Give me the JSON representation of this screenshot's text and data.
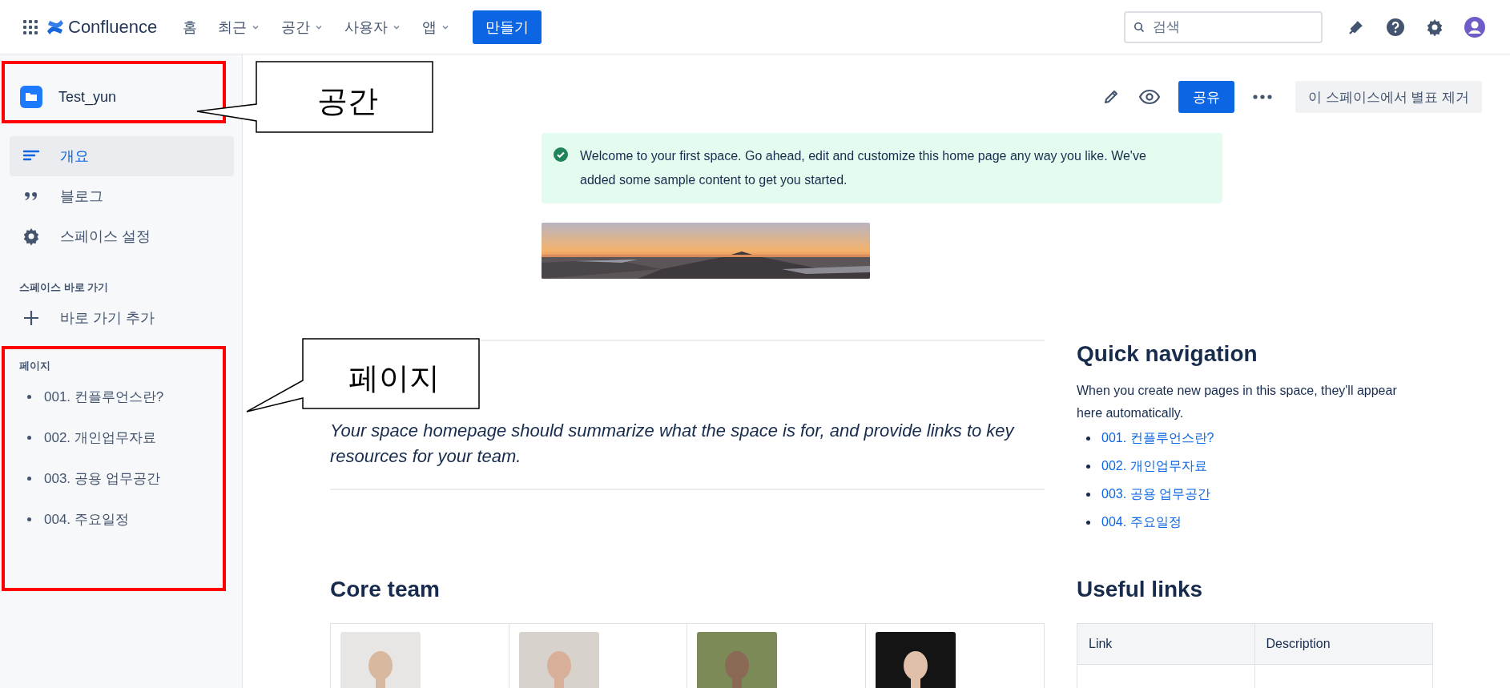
{
  "topbar": {
    "product": "Confluence",
    "nav": [
      {
        "label": "홈",
        "dropdown": false
      },
      {
        "label": "최근",
        "dropdown": true
      },
      {
        "label": "공간",
        "dropdown": true
      },
      {
        "label": "사용자",
        "dropdown": true
      },
      {
        "label": "앱",
        "dropdown": true
      }
    ],
    "create_button": "만들기",
    "search": {
      "placeholder": "검색"
    }
  },
  "sidebar": {
    "space_name": "Test_yun",
    "items": [
      {
        "label": "개요",
        "kind": "overview",
        "selected": true
      },
      {
        "label": "블로그",
        "kind": "blog",
        "selected": false
      },
      {
        "label": "스페이스 설정",
        "kind": "settings",
        "selected": false
      }
    ],
    "shortcuts": {
      "heading": "스페이스 바로 가기",
      "add": "바로 가기 추가"
    },
    "pages": {
      "heading": "페이지",
      "items": [
        "001. 컨플루언스란?",
        "002. 개인업무자료",
        "003. 공용 업무공간",
        "004. 주요일정"
      ]
    }
  },
  "page_toolbar": {
    "share_button": "공유",
    "unstar_button": "이 스페이스에서 별표 제거"
  },
  "info_panel": {
    "text": "Welcome to your first space. Go ahead, edit and customize this home page any way you like. We've added some sample content to get you started."
  },
  "goal": {
    "text": "Your space homepage should summarize what the space is for, and provide links to key resources for your team."
  },
  "quick_navigation": {
    "title": "Quick navigation",
    "text": "When you create new pages in this space, they'll appear here automatically.",
    "links": [
      "001. 컨플루언스란?",
      "002. 개인업무자료",
      "003. 공용 업무공간",
      "004. 주요일정"
    ]
  },
  "core_team": {
    "title": "Core team"
  },
  "useful_links": {
    "title": "Useful links",
    "columns": [
      "Link",
      "Description"
    ]
  },
  "annotations": [
    {
      "label": "공간",
      "kind": "space"
    },
    {
      "label": "페이지",
      "kind": "pages"
    }
  ]
}
